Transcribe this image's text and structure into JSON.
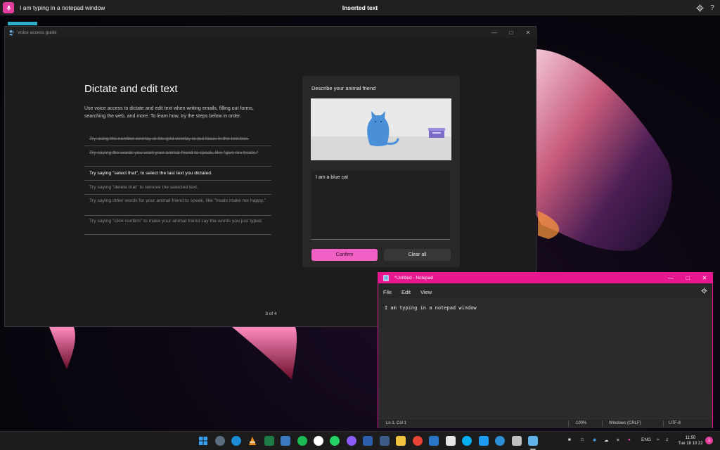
{
  "voice_access": {
    "last_phrase": "I am typing in a notepad window",
    "status": "Inserted text",
    "settings_icon": "gear-icon",
    "help_label": "?"
  },
  "guide": {
    "window_title": "Voice access guide",
    "heading": "Dictate and edit text",
    "intro": "Use voice access to dictate and edit text when writing emails, filling out forms, searching the web, and more. To learn how, try the steps below in order.",
    "steps": [
      {
        "text": "Try using the number overlay or the grid overlay to put focus in the text box.",
        "state": "done"
      },
      {
        "text": "Try saying the words you want your animal friend to speak, like \"give me treats.\"",
        "state": "done"
      },
      {
        "text": "Try saying \"select that\", to select the last text you dictated.",
        "state": "active"
      },
      {
        "text": "Try saying \"delete that\" to remove the selected text.",
        "state": "todo"
      },
      {
        "text": "Try saying other words for your animal friend to speak, like \"treats make me happy.\"",
        "state": "todo"
      },
      {
        "text": "Try saying \"click confirm\" to make your animal friend say the words you just typed.",
        "state": "todo"
      }
    ],
    "page": "3 of 4",
    "demo": {
      "title": "Describe your animal friend",
      "text_value": "I am a blue cat",
      "confirm_label": "Confirm",
      "clear_label": "Clear all",
      "cat_color": "#4a90d9",
      "accent_color": "#f060c5"
    }
  },
  "notepad": {
    "title": "*Untitled - Notepad",
    "menu": [
      "File",
      "Edit",
      "View"
    ],
    "content": "I am typing in a notepad window",
    "status": {
      "position": "Ln 1, Col 1",
      "zoom": "100%",
      "line_ending": "Windows (CRLF)",
      "encoding": "UTF-8"
    },
    "accent_color": "#e9178f"
  },
  "taskbar": {
    "apps": [
      "start-icon",
      "settings-icon",
      "edge-icon",
      "vlc-icon",
      "excel-icon",
      "store-icon",
      "spotify-icon",
      "slack-icon",
      "whatsapp-icon",
      "messenger-icon",
      "word-icon",
      "news-icon",
      "file-explorer-icon",
      "chrome-icon",
      "calendar-icon",
      "skype-icon",
      "twitter-icon",
      "people-icon",
      "snipping-tool-icon",
      "notepad-icon"
    ],
    "tray": {
      "language": "ENG",
      "time": "11:50",
      "date": "Tue 18 10 22",
      "notification_count": "1"
    }
  }
}
